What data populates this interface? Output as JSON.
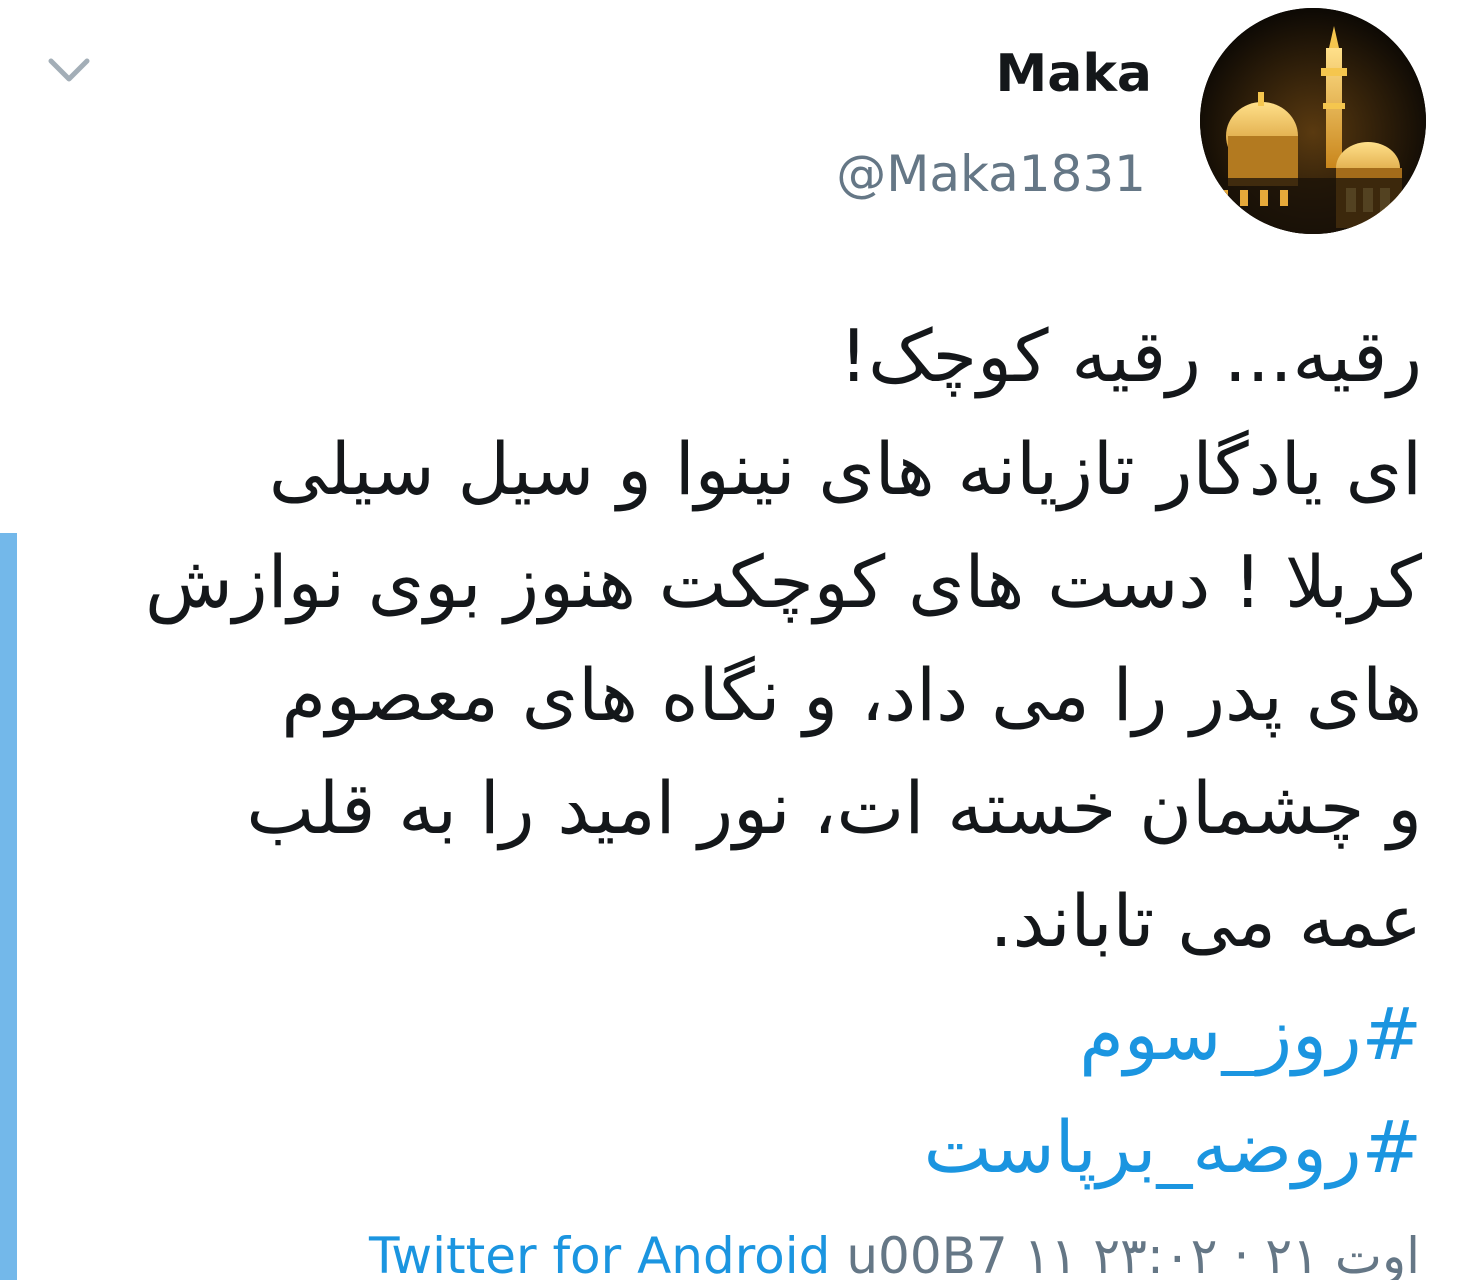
{
  "tweet": {
    "display_name": "Maka",
    "handle": "@Maka1831",
    "text_lines": [
      "رقیه... رقیه کوچک!",
      "ای یادگار تازیانه های نینوا و سیل سیلی",
      "کربلا ! دست های کوچکت هنوز بوی نوازش",
      "های پدر را می داد، و نگاه های معصوم",
      "و چشمان خسته ات، نور امید را به قلب",
      "عمه می تاباند."
    ],
    "hashtags": [
      "#روز_سوم",
      "#روضه_برپاست"
    ],
    "time": "۲۳:۰۲",
    "separator": "·",
    "date": "۱۱ اوت ۲۱",
    "source_escape": "u00B7",
    "source": "Twitter for Android"
  },
  "icons": {
    "menu": "chevron-down-icon",
    "avatar": "shrine-dome-avatar"
  },
  "colors": {
    "text": "#14171a",
    "secondary": "#657786",
    "link": "#1b95e0",
    "accent_bar": "#73b8ea",
    "avatar_gold": "#e8b13a"
  }
}
